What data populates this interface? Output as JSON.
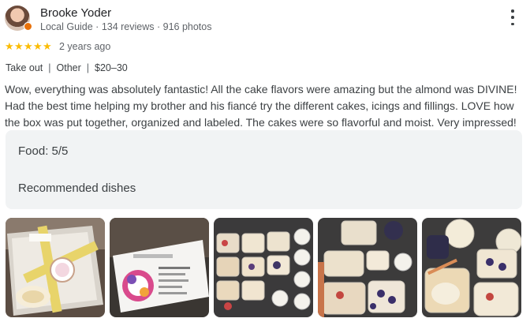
{
  "reviewer": {
    "name": "Brooke Yoder",
    "meta": "Local Guide · 134 reviews · 916 photos"
  },
  "rating": {
    "stars": 5,
    "max": 5,
    "time": "2 years ago"
  },
  "chips": [
    "Take out",
    "Other",
    "$20–30"
  ],
  "review_text": "Wow, everything was absolutely fantastic! All the cake flavors were amazing but the almond was DIVINE! Had the best time helping my brother and his fiancé try the different cakes, icings and fillings. LOVE how the box was put together, organized and labeled. The cakes were so flavorful and moist. Very impressed!",
  "details": {
    "food": "Food: 5/5",
    "recommended": "Recommended dishes"
  },
  "photos": [
    {
      "name": "photo-cake-box-ribbon"
    },
    {
      "name": "photo-business-card"
    },
    {
      "name": "photo-cake-sample-cups"
    },
    {
      "name": "photo-labeled-cake-cups"
    },
    {
      "name": "photo-cake-cups-closeup"
    }
  ],
  "colors": {
    "star": "#fbbc04",
    "text": "#3c4043",
    "muted": "#5f6368",
    "panel": "#f1f3f4"
  }
}
